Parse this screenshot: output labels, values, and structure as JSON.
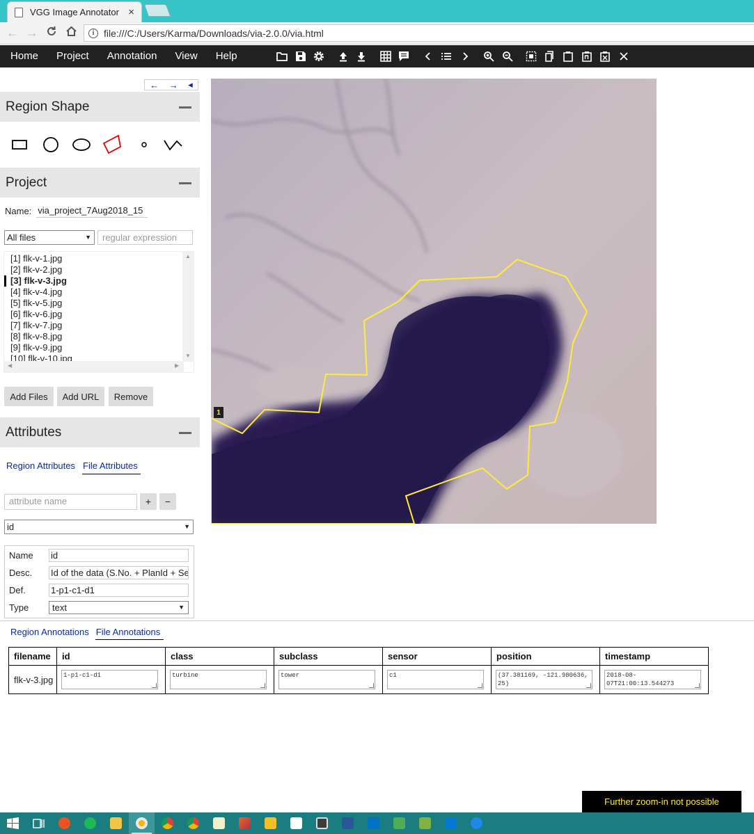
{
  "browser": {
    "tab_title": "VGG Image Annotator",
    "tab_close": "×",
    "url": "file:///C:/Users/Karma/Downloads/via-2.0.0/via.html"
  },
  "menu": {
    "items": [
      "Home",
      "Project",
      "Annotation",
      "View",
      "Help"
    ],
    "toolbar_icons": [
      "folder-open-icon",
      "save-icon",
      "settings-icon",
      "upload-icon",
      "download-icon",
      "grid-view-icon",
      "comment-icon",
      "prev-image-icon",
      "list-icon",
      "next-image-icon",
      "zoom-in-icon",
      "zoom-out-icon",
      "select-all-icon",
      "copy-icon",
      "paste-icon",
      "paste-n-icon",
      "delete-icon",
      "close-icon"
    ]
  },
  "left_panel": {
    "history_nav": {
      "back": "←",
      "forward": "→",
      "collapse": "◂"
    },
    "region_shape": {
      "title": "Region Shape",
      "shapes": [
        "rectangle",
        "circle",
        "ellipse",
        "polygon",
        "point",
        "polyline"
      ],
      "active_shape": "polygon",
      "active_color": "#e00000"
    },
    "project": {
      "title": "Project",
      "name_label": "Name:",
      "name_value": "via_project_7Aug2018_15",
      "filter_value": "All files",
      "regex_placeholder": "regular expression",
      "files": [
        "[1] flk-v-1.jpg",
        "[2] flk-v-2.jpg",
        "[3] flk-v-3.jpg",
        "[4] flk-v-4.jpg",
        "[5] flk-v-5.jpg",
        "[6] flk-v-6.jpg",
        "[7] flk-v-7.jpg",
        "[8] flk-v-8.jpg",
        "[9] flk-v-9.jpg",
        "[10] flk-v-10.jpg"
      ],
      "current_index": 2,
      "buttons": {
        "add_files": "Add Files",
        "add_url": "Add URL",
        "remove": "Remove"
      }
    },
    "attributes": {
      "title": "Attributes",
      "tabs": [
        "Region Attributes",
        "File Attributes"
      ],
      "active_tab": 1,
      "attr_name_placeholder": "attribute name",
      "add_label": "+",
      "remove_label": "−",
      "selected_attr": "id",
      "form": {
        "name_label": "Name",
        "name_value": "id",
        "desc_label": "Desc.",
        "desc_value": "Id of the data (S.No. + PlanId + Se",
        "def_label": "Def.",
        "def_value": "1-p1-c1-d1",
        "type_label": "Type",
        "type_value": "text"
      }
    }
  },
  "canvas": {
    "region_id": "1",
    "region_color": "#ffeb3b"
  },
  "annotations": {
    "tabs": [
      "Region Annotations",
      "File Annotations"
    ],
    "active_tab": 1,
    "columns": [
      "filename",
      "id",
      "class",
      "subclass",
      "sensor",
      "position",
      "timestamp"
    ],
    "rows": [
      {
        "filename": "flk-v-3.jpg",
        "id": "1-p1-c1-d1",
        "class": "turbine",
        "subclass": "tower",
        "sensor": "c1",
        "position": "(37.381169, -121.980636, 25)",
        "timestamp": "2018-08-07T21:00:13.544273"
      }
    ]
  },
  "toast": "Further zoom-in not possible",
  "taskbar": {
    "icons": [
      "windows-start-icon",
      "task-view-icon",
      "ubuntu-icon",
      "spotify-icon",
      "file-explorer-icon",
      "chrome-canary-icon",
      "chrome-icon",
      "chrome-alt-icon",
      "notepad-icon",
      "matlab-icon",
      "keep-icon",
      "sticky-notes-icon",
      "snipping-tool-icon",
      "word-icon",
      "outlook-icon",
      "network-icon",
      "lambda-icon",
      "vscode-icon",
      "edge-icon"
    ],
    "active_icon": "chrome-canary-icon"
  }
}
